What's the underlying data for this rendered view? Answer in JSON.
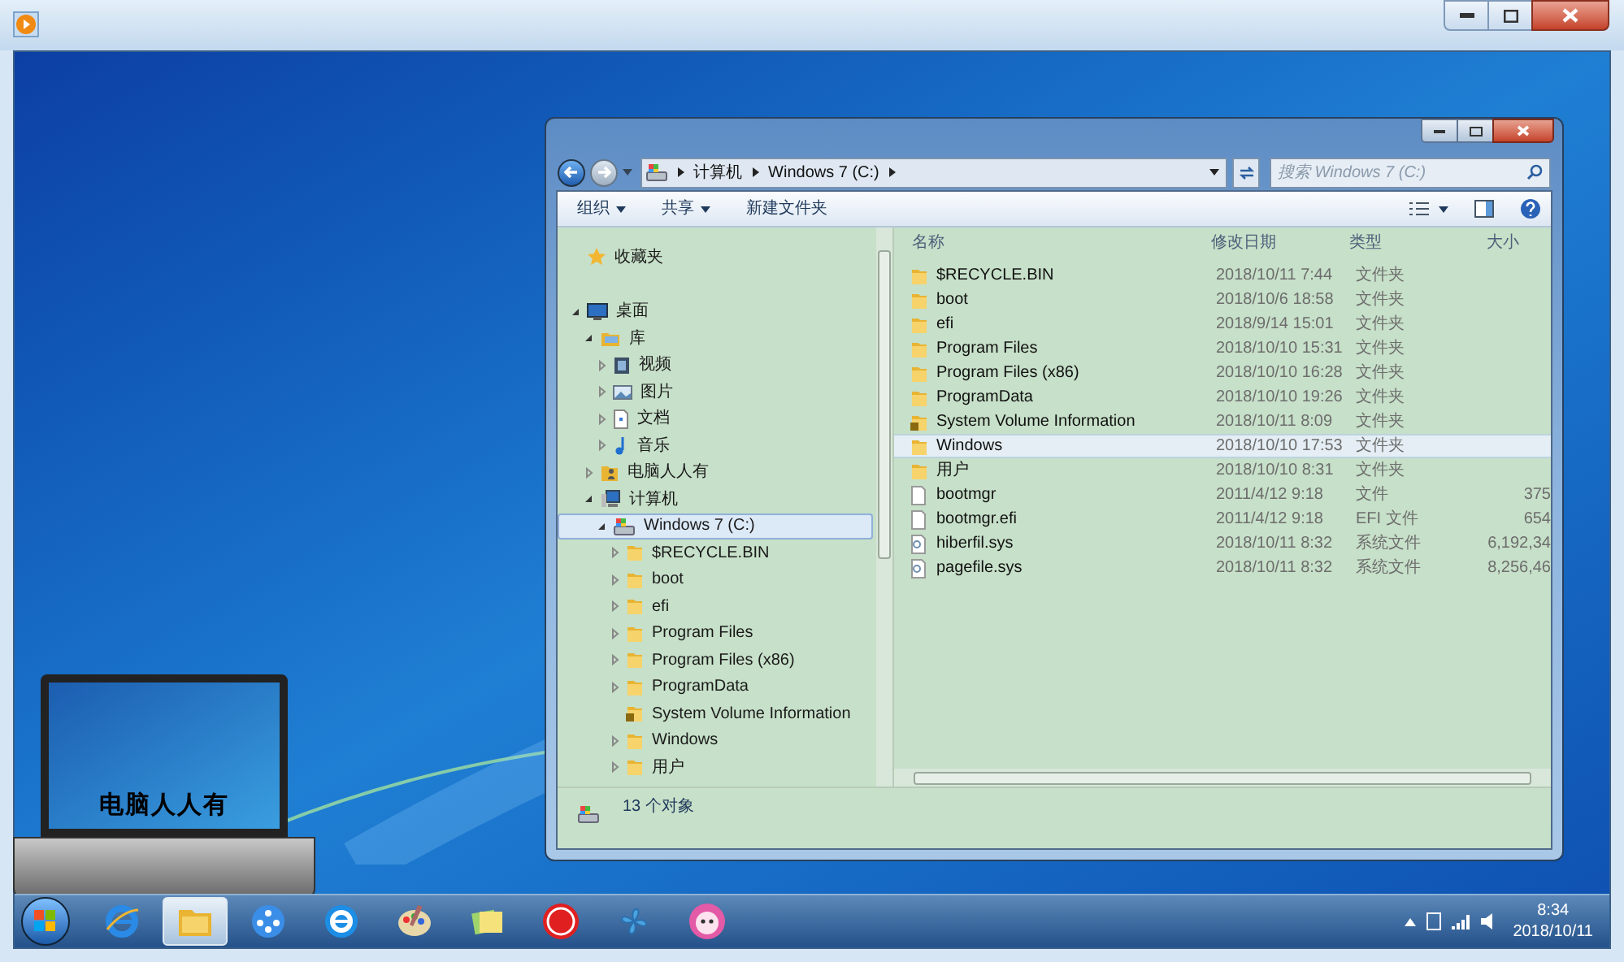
{
  "explorer": {
    "path": [
      {
        "label": "计算机"
      },
      {
        "label": "Windows 7 (C:)"
      }
    ],
    "search": {
      "placeholder": "搜索 Windows 7 (C:)"
    },
    "toolbar": [
      {
        "label": "组织",
        "dropdown": true
      },
      {
        "label": "共享",
        "dropdown": true
      },
      {
        "label": "新建文件夹",
        "dropdown": false
      }
    ],
    "tree": [
      {
        "label": "收藏夹",
        "kind": "star",
        "selected": false
      },
      {
        "label": "桌面",
        "kind": "desktop",
        "expanded": true,
        "selected": false,
        "children": [
          {
            "label": "库",
            "kind": "library",
            "expanded": true,
            "selected": false,
            "children": [
              {
                "label": "视频",
                "kind": "video",
                "expanded": false,
                "selected": false
              },
              {
                "label": "图片",
                "kind": "picture",
                "expanded": false,
                "selected": false
              },
              {
                "label": "文档",
                "kind": "document",
                "expanded": false,
                "selected": false
              },
              {
                "label": "音乐",
                "kind": "music",
                "expanded": false,
                "selected": false
              }
            ]
          },
          {
            "label": "电脑人人有",
            "kind": "user",
            "expanded": false,
            "selected": false
          },
          {
            "label": "计算机",
            "kind": "computer",
            "expanded": true,
            "selected": false,
            "children": [
              {
                "label": "Windows 7 (C:)",
                "kind": "drive",
                "expanded": true,
                "selected": true,
                "children": [
                  {
                    "label": "$RECYCLE.BIN",
                    "kind": "folder",
                    "expanded": false,
                    "selected": false
                  },
                  {
                    "label": "boot",
                    "kind": "folder",
                    "expanded": false,
                    "selected": false
                  },
                  {
                    "label": "efi",
                    "kind": "folder",
                    "expanded": false,
                    "selected": false
                  },
                  {
                    "label": "Program Files",
                    "kind": "folder",
                    "expanded": false,
                    "selected": false
                  },
                  {
                    "label": "Program Files (x86)",
                    "kind": "folder",
                    "expanded": false,
                    "selected": false
                  },
                  {
                    "label": "ProgramData",
                    "kind": "folder",
                    "expanded": false,
                    "selected": false
                  },
                  {
                    "label": "System Volume Information",
                    "kind": "locked",
                    "selected": false
                  },
                  {
                    "label": "Windows",
                    "kind": "folder",
                    "expanded": false,
                    "selected": false
                  },
                  {
                    "label": "用户",
                    "kind": "folder",
                    "expanded": false,
                    "selected": false
                  }
                ]
              }
            ]
          }
        ]
      }
    ],
    "columns": [
      "名称",
      "修改日期",
      "类型",
      "大小"
    ],
    "files": [
      {
        "name": "$RECYCLE.BIN",
        "date": "2018/10/11 7:44",
        "type": "文件夹",
        "kind": "folder",
        "hovered": false
      },
      {
        "name": "boot",
        "date": "2018/10/6 18:58",
        "type": "文件夹",
        "kind": "folder",
        "hovered": false
      },
      {
        "name": "efi",
        "date": "2018/9/14 15:01",
        "type": "文件夹",
        "kind": "folder",
        "hovered": false
      },
      {
        "name": "Program Files",
        "date": "2018/10/10 15:31",
        "type": "文件夹",
        "kind": "folder",
        "hovered": false
      },
      {
        "name": "Program Files (x86)",
        "date": "2018/10/10 16:28",
        "type": "文件夹",
        "kind": "folder",
        "hovered": false
      },
      {
        "name": "ProgramData",
        "date": "2018/10/10 19:26",
        "type": "文件夹",
        "kind": "folder",
        "hovered": false
      },
      {
        "name": "System Volume Information",
        "date": "2018/10/11 8:09",
        "type": "文件夹",
        "kind": "locked",
        "hovered": false
      },
      {
        "name": "Windows",
        "date": "2018/10/10 17:53",
        "type": "文件夹",
        "kind": "folder",
        "hovered": true
      },
      {
        "name": "用户",
        "date": "2018/10/10 8:31",
        "type": "文件夹",
        "kind": "folder",
        "hovered": false
      },
      {
        "name": "bootmgr",
        "date": "2011/4/12 9:18",
        "type": "文件",
        "size": "375",
        "kind": "file",
        "hovered": false
      },
      {
        "name": "bootmgr.efi",
        "date": "2011/4/12 9:18",
        "type": "EFI 文件",
        "size": "654",
        "kind": "file",
        "hovered": false
      },
      {
        "name": "hiberfil.sys",
        "date": "2018/10/11 8:32",
        "type": "系统文件",
        "size": "6,192,34",
        "kind": "system",
        "hovered": false
      },
      {
        "name": "pagefile.sys",
        "date": "2018/10/11 8:32",
        "type": "系统文件",
        "size": "8,256,46",
        "kind": "system",
        "hovered": false
      }
    ],
    "status": "13 个对象"
  },
  "logo": {
    "text": "电脑人人有"
  },
  "taskbar": [
    {
      "kind": "ie",
      "selected": false
    },
    {
      "kind": "explorer",
      "selected": true
    },
    {
      "kind": "media",
      "selected": false
    },
    {
      "kind": "browser",
      "selected": false
    },
    {
      "kind": "paint",
      "selected": false
    },
    {
      "kind": "notes",
      "selected": false
    },
    {
      "kind": "chess",
      "selected": false
    },
    {
      "kind": "pinwheel",
      "selected": false
    },
    {
      "kind": "game",
      "selected": false
    }
  ],
  "clock": {
    "time": "8:34",
    "date": "2018/10/11"
  }
}
